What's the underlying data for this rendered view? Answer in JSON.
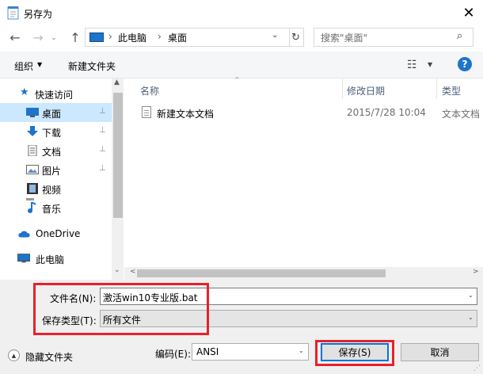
{
  "window": {
    "title": "另存为",
    "close": "✕"
  },
  "nav": {
    "back": "←",
    "forward": "→",
    "recent": "⌄",
    "up": "↑",
    "address": {
      "sep": "›",
      "crumbs": [
        "此电脑",
        "桌面"
      ],
      "dropdown": "⌄"
    },
    "refresh": "↻",
    "search": {
      "placeholder": "搜索\"桌面\"",
      "icon": "⌕"
    }
  },
  "toolbar": {
    "organize": "组织",
    "caret": "▼",
    "new_folder": "新建文件夹",
    "view_icon": "☷",
    "help": "?"
  },
  "sidebar": {
    "items": [
      {
        "label": "快速访问",
        "icon": "star-icon"
      },
      {
        "label": "桌面",
        "icon": "desktop-icon",
        "pinned": true,
        "selected": true
      },
      {
        "label": "下载",
        "icon": "download-icon",
        "pinned": true
      },
      {
        "label": "文档",
        "icon": "document-icon",
        "pinned": true
      },
      {
        "label": "图片",
        "icon": "picture-icon",
        "pinned": true
      },
      {
        "label": "视频",
        "icon": "video-icon"
      },
      {
        "label": "音乐",
        "icon": "music-icon"
      },
      {
        "label": "OneDrive",
        "icon": "cloud-icon"
      },
      {
        "label": "此电脑",
        "icon": "computer-icon"
      }
    ],
    "pin_glyph": "📌"
  },
  "files": {
    "columns": {
      "name": "名称",
      "date": "修改日期",
      "type": "类型"
    },
    "sort_indicator": "^",
    "rows": [
      {
        "name": "新建文本文档",
        "date": "2015/7/28 10:04",
        "type": "文本文档"
      }
    ]
  },
  "scroll": {
    "up": "▲",
    "down": "⌄",
    "left": "<",
    "right": ">"
  },
  "form": {
    "filename_label": "文件名(N):",
    "filename_value": "激活win10专业版.bat",
    "filetype_label": "保存类型(T):",
    "filetype_value": "所有文件",
    "caret": "⌄",
    "hide_folders": "隐藏文件夹",
    "hide_icon": "▲",
    "encoding_label": "编码(E):",
    "encoding_value": "ANSI",
    "save": "保存(S)",
    "cancel": "取消"
  },
  "colors": {
    "accent": "#1e74c8",
    "selection": "#cce8ff",
    "highlight": "#e8212c",
    "panel": "#f0f0f0"
  }
}
